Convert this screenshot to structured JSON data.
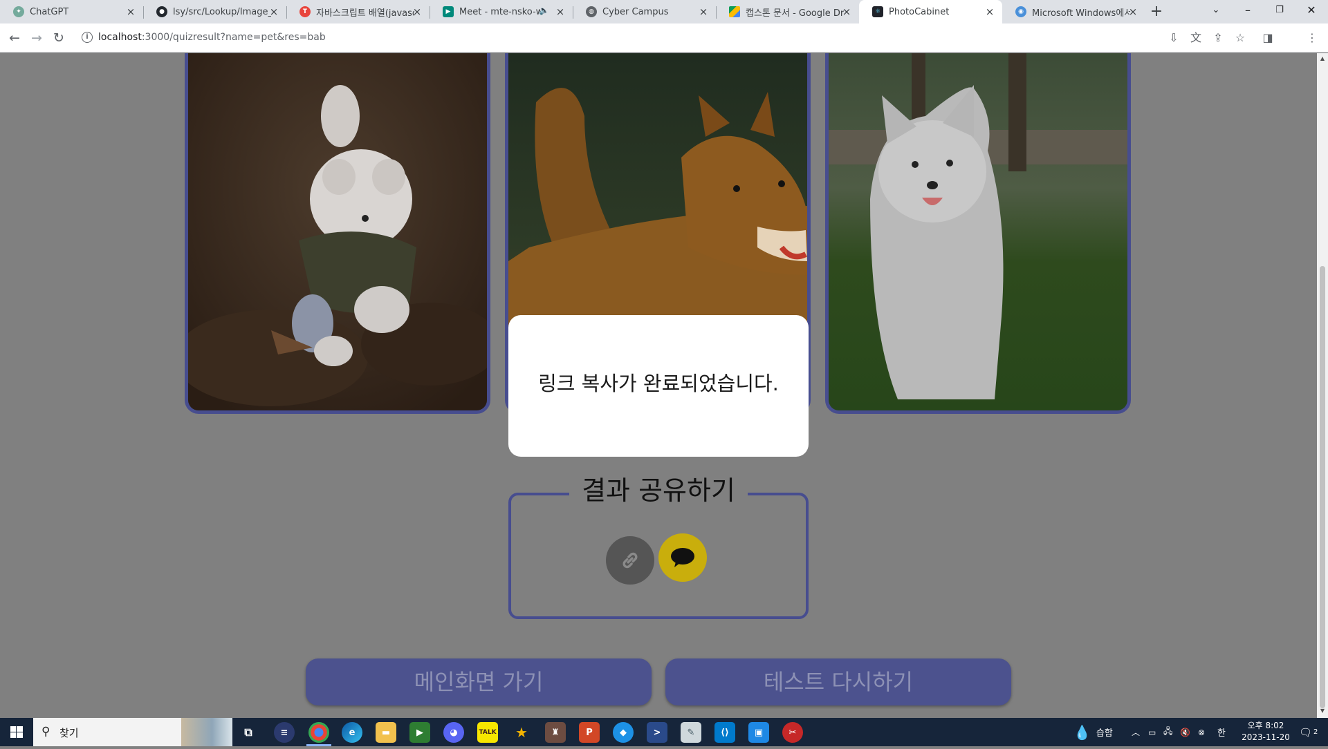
{
  "browser": {
    "tabs": [
      {
        "title": "ChatGPT",
        "icon": "chatgpt-icon",
        "color": "#74aa9c"
      },
      {
        "title": "lsy/src/Lookup/Image_Lo",
        "icon": "github-icon",
        "color": "#24292f"
      },
      {
        "title": "자바스크립트 배열(javasc",
        "icon": "red-t-icon",
        "color": "#e8453c"
      },
      {
        "title": "Meet - mte-nsko-wp",
        "icon": "meet-icon",
        "color": "#00897b"
      },
      {
        "title": "Cyber Campus",
        "icon": "globe-icon",
        "color": "#5f6368"
      },
      {
        "title": "캡스톤 문서 - Google Dri",
        "icon": "drive-icon",
        "color": "#fbbc04"
      },
      {
        "title": "PhotoCabinet",
        "icon": "react-icon",
        "color": "#20232a"
      },
      {
        "title": "Microsoft Windows에서",
        "icon": "edge-page-icon",
        "color": "#4a90d9"
      }
    ],
    "active_tab": 6,
    "url_host": "localhost",
    "url_rest": ":3000/quizresult?name=pet&res=bab"
  },
  "page": {
    "photos": [
      {
        "alt": "white-puppy-running-photo"
      },
      {
        "alt": "corgi-photo"
      },
      {
        "alt": "samoyed-puppy-photo"
      }
    ],
    "modal_message": "링크 복사가 완료되었습니다.",
    "share_title": "결과 공유하기",
    "share_buttons": [
      {
        "icon": "link-icon",
        "color": "#555555"
      },
      {
        "icon": "kakao-talk-icon",
        "color": "#c9ae0c"
      }
    ],
    "main_button": "메인화면 가기",
    "retry_button": "테스트 다시하기",
    "accent_color": "#474d8f"
  },
  "taskbar": {
    "search_placeholder": "찾기",
    "weather_text": "습함",
    "time": "오후 8:02",
    "date": "2023-11-20",
    "notification_count": "2"
  }
}
